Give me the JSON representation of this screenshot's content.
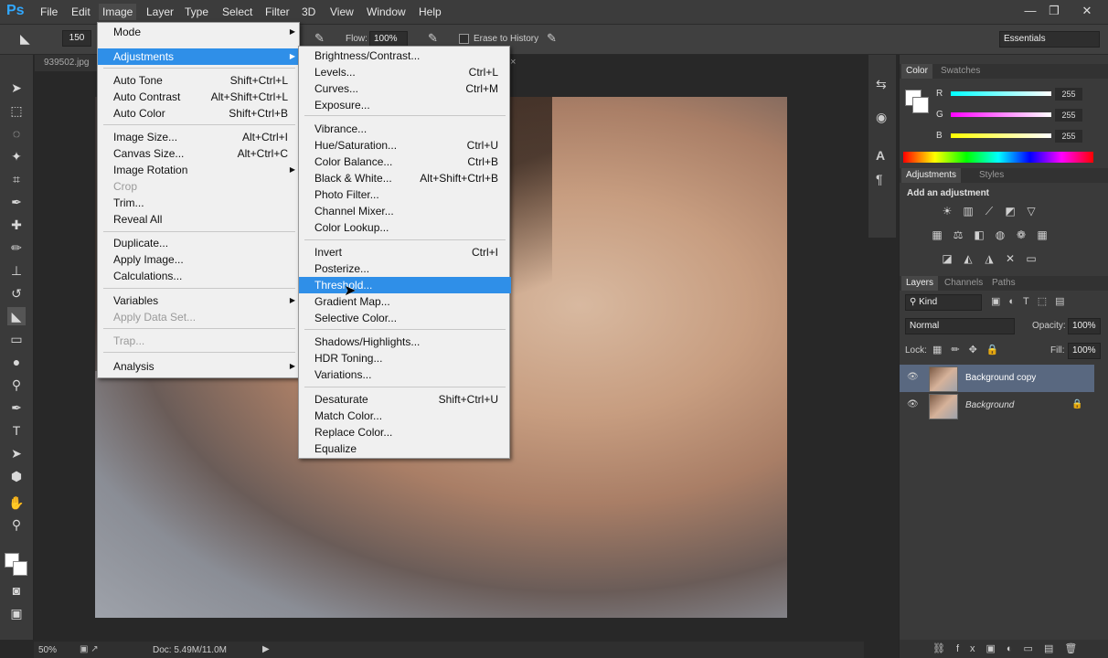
{
  "app": {
    "logo": "Ps"
  },
  "menubar": {
    "items": [
      "File",
      "Edit",
      "Image",
      "Layer",
      "Type",
      "Select",
      "Filter",
      "3D",
      "View",
      "Window",
      "Help"
    ],
    "window_controls": [
      "—",
      "❐",
      "✕"
    ]
  },
  "options": {
    "brush_size": "150",
    "flow_label": "Flow:",
    "flow_value": "100%",
    "erase_to_history": "Erase to History",
    "workspace": "Essentials"
  },
  "document": {
    "tab": "939502.jpg",
    "close": "×"
  },
  "status": {
    "zoom": "50%",
    "doc": "Doc: 5.49M/11.0M"
  },
  "image_menu": {
    "items": [
      {
        "label": "Mode",
        "shortcut": "",
        "submenu": true
      },
      {
        "label": "Adjustments",
        "shortcut": "",
        "submenu": true,
        "highlight": true
      },
      {
        "label": "Auto Tone",
        "shortcut": "Shift+Ctrl+L"
      },
      {
        "label": "Auto Contrast",
        "shortcut": "Alt+Shift+Ctrl+L"
      },
      {
        "label": "Auto Color",
        "shortcut": "Shift+Ctrl+B"
      },
      {
        "label": "Image Size...",
        "shortcut": "Alt+Ctrl+I"
      },
      {
        "label": "Canvas Size...",
        "shortcut": "Alt+Ctrl+C"
      },
      {
        "label": "Image Rotation",
        "shortcut": "",
        "submenu": true
      },
      {
        "label": "Crop",
        "shortcut": "",
        "disabled": true
      },
      {
        "label": "Trim...",
        "shortcut": ""
      },
      {
        "label": "Reveal All",
        "shortcut": ""
      },
      {
        "label": "Duplicate...",
        "shortcut": ""
      },
      {
        "label": "Apply Image...",
        "shortcut": ""
      },
      {
        "label": "Calculations...",
        "shortcut": ""
      },
      {
        "label": "Variables",
        "shortcut": "",
        "submenu": true
      },
      {
        "label": "Apply Data Set...",
        "shortcut": "",
        "disabled": true
      },
      {
        "label": "Trap...",
        "shortcut": "",
        "disabled": true
      },
      {
        "label": "Analysis",
        "shortcut": "",
        "submenu": true
      }
    ]
  },
  "adjust_menu": {
    "items": [
      {
        "label": "Brightness/Contrast...",
        "shortcut": ""
      },
      {
        "label": "Levels...",
        "shortcut": "Ctrl+L"
      },
      {
        "label": "Curves...",
        "shortcut": "Ctrl+M"
      },
      {
        "label": "Exposure...",
        "shortcut": ""
      },
      {
        "label": "Vibrance...",
        "shortcut": ""
      },
      {
        "label": "Hue/Saturation...",
        "shortcut": "Ctrl+U"
      },
      {
        "label": "Color Balance...",
        "shortcut": "Ctrl+B"
      },
      {
        "label": "Black & White...",
        "shortcut": "Alt+Shift+Ctrl+B"
      },
      {
        "label": "Photo Filter...",
        "shortcut": ""
      },
      {
        "label": "Channel Mixer...",
        "shortcut": ""
      },
      {
        "label": "Color Lookup...",
        "shortcut": ""
      },
      {
        "label": "Invert",
        "shortcut": "Ctrl+I"
      },
      {
        "label": "Posterize...",
        "shortcut": ""
      },
      {
        "label": "Threshold...",
        "shortcut": "",
        "highlight": true
      },
      {
        "label": "Gradient Map...",
        "shortcut": ""
      },
      {
        "label": "Selective Color...",
        "shortcut": ""
      },
      {
        "label": "Shadows/Highlights...",
        "shortcut": ""
      },
      {
        "label": "HDR Toning...",
        "shortcut": ""
      },
      {
        "label": "Variations...",
        "shortcut": ""
      },
      {
        "label": "Desaturate",
        "shortcut": "Shift+Ctrl+U"
      },
      {
        "label": "Match Color...",
        "shortcut": ""
      },
      {
        "label": "Replace Color...",
        "shortcut": ""
      },
      {
        "label": "Equalize",
        "shortcut": ""
      }
    ]
  },
  "color_panel": {
    "tabs": [
      "Color",
      "Swatches"
    ],
    "channels": [
      {
        "name": "R",
        "value": "255",
        "color": "#2fe0f0"
      },
      {
        "name": "G",
        "value": "255",
        "color": "#e040e0"
      },
      {
        "name": "B",
        "value": "255",
        "color": "#f0f040"
      }
    ]
  },
  "adjust_panel": {
    "tabs": [
      "Adjustments",
      "Styles"
    ],
    "heading": "Add an adjustment"
  },
  "layers_panel": {
    "tabs": [
      "Layers",
      "Channels",
      "Paths"
    ],
    "kind": "Kind",
    "blend": "Normal",
    "opacity_label": "Opacity:",
    "opacity": "100%",
    "lock_label": "Lock:",
    "fill_label": "Fill:",
    "fill": "100%",
    "layers": [
      {
        "name": "Background copy",
        "selected": true
      },
      {
        "name": "Background",
        "locked": true
      }
    ]
  },
  "colors": {
    "highlight": "#2f8fe8",
    "accent": "#31a8ff"
  }
}
